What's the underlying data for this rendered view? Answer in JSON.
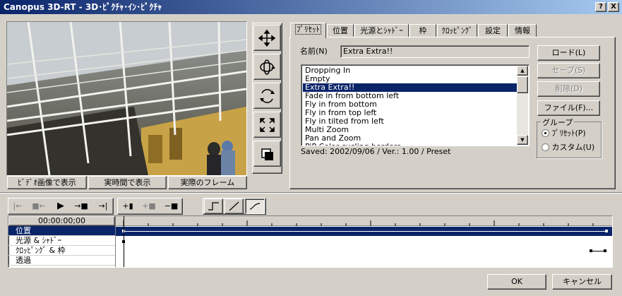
{
  "window": {
    "title": "Canopus 3D-RT - 3D･ﾋﾟｸﾁｬ･ｲﾝ･ﾋﾟｸﾁｬ",
    "help_btn": "?",
    "close_btn": "X"
  },
  "preview": {
    "buttons": [
      "ﾋﾞﾃﾞｵ画像で表示",
      "実時間で表示",
      "実際のフレーム"
    ]
  },
  "tools": [
    "move-icon",
    "rotate-3d-icon",
    "rotate-icon",
    "resize-icon",
    "layer-icon"
  ],
  "tabs": [
    "ﾌﾟﾘｾｯﾄ",
    "位置",
    "光源とｼｬﾄﾞｰ",
    "枠",
    "ｸﾛｯﾋﾟﾝｸﾞ",
    "設定",
    "情報"
  ],
  "preset": {
    "name_label": "名前(N)",
    "name_value": "Extra Extra!!",
    "list": [
      "Dropping In",
      "Empty",
      "Extra Extra!!",
      "Fade in from bottom left",
      "Fly in from bottom",
      "Fly in from top left",
      "Fly in tilted from left",
      "Multi Zoom",
      "Pan and Zoom",
      "PiP Color cycling borders"
    ],
    "selected_index": 2,
    "status": "Saved: 2002/09/06 / Ver.: 1.00 / Preset",
    "load_btn": "ロード(L)",
    "save_btn": "セーブ(S)",
    "delete_btn": "削除(D)",
    "file_btn": "ファイル(F)...",
    "group_label": "グループ",
    "radio_preset": "ﾌﾟﾘｾｯﾄ(P)",
    "radio_custom": "カスタム(U)",
    "group_selected": "preset"
  },
  "timeline": {
    "timecode": "00:00:00;00",
    "tracks": [
      "位置",
      "光源 & ｼｬﾄﾞｰ",
      "ｸﾛｯﾋﾟﾝｸﾞ & 枠",
      "透過"
    ],
    "selected_track": 0
  },
  "footer": {
    "ok": "OK",
    "cancel": "キャンセル"
  },
  "colors": {
    "selection": "#0a246a",
    "face": "#d4d0c8"
  }
}
